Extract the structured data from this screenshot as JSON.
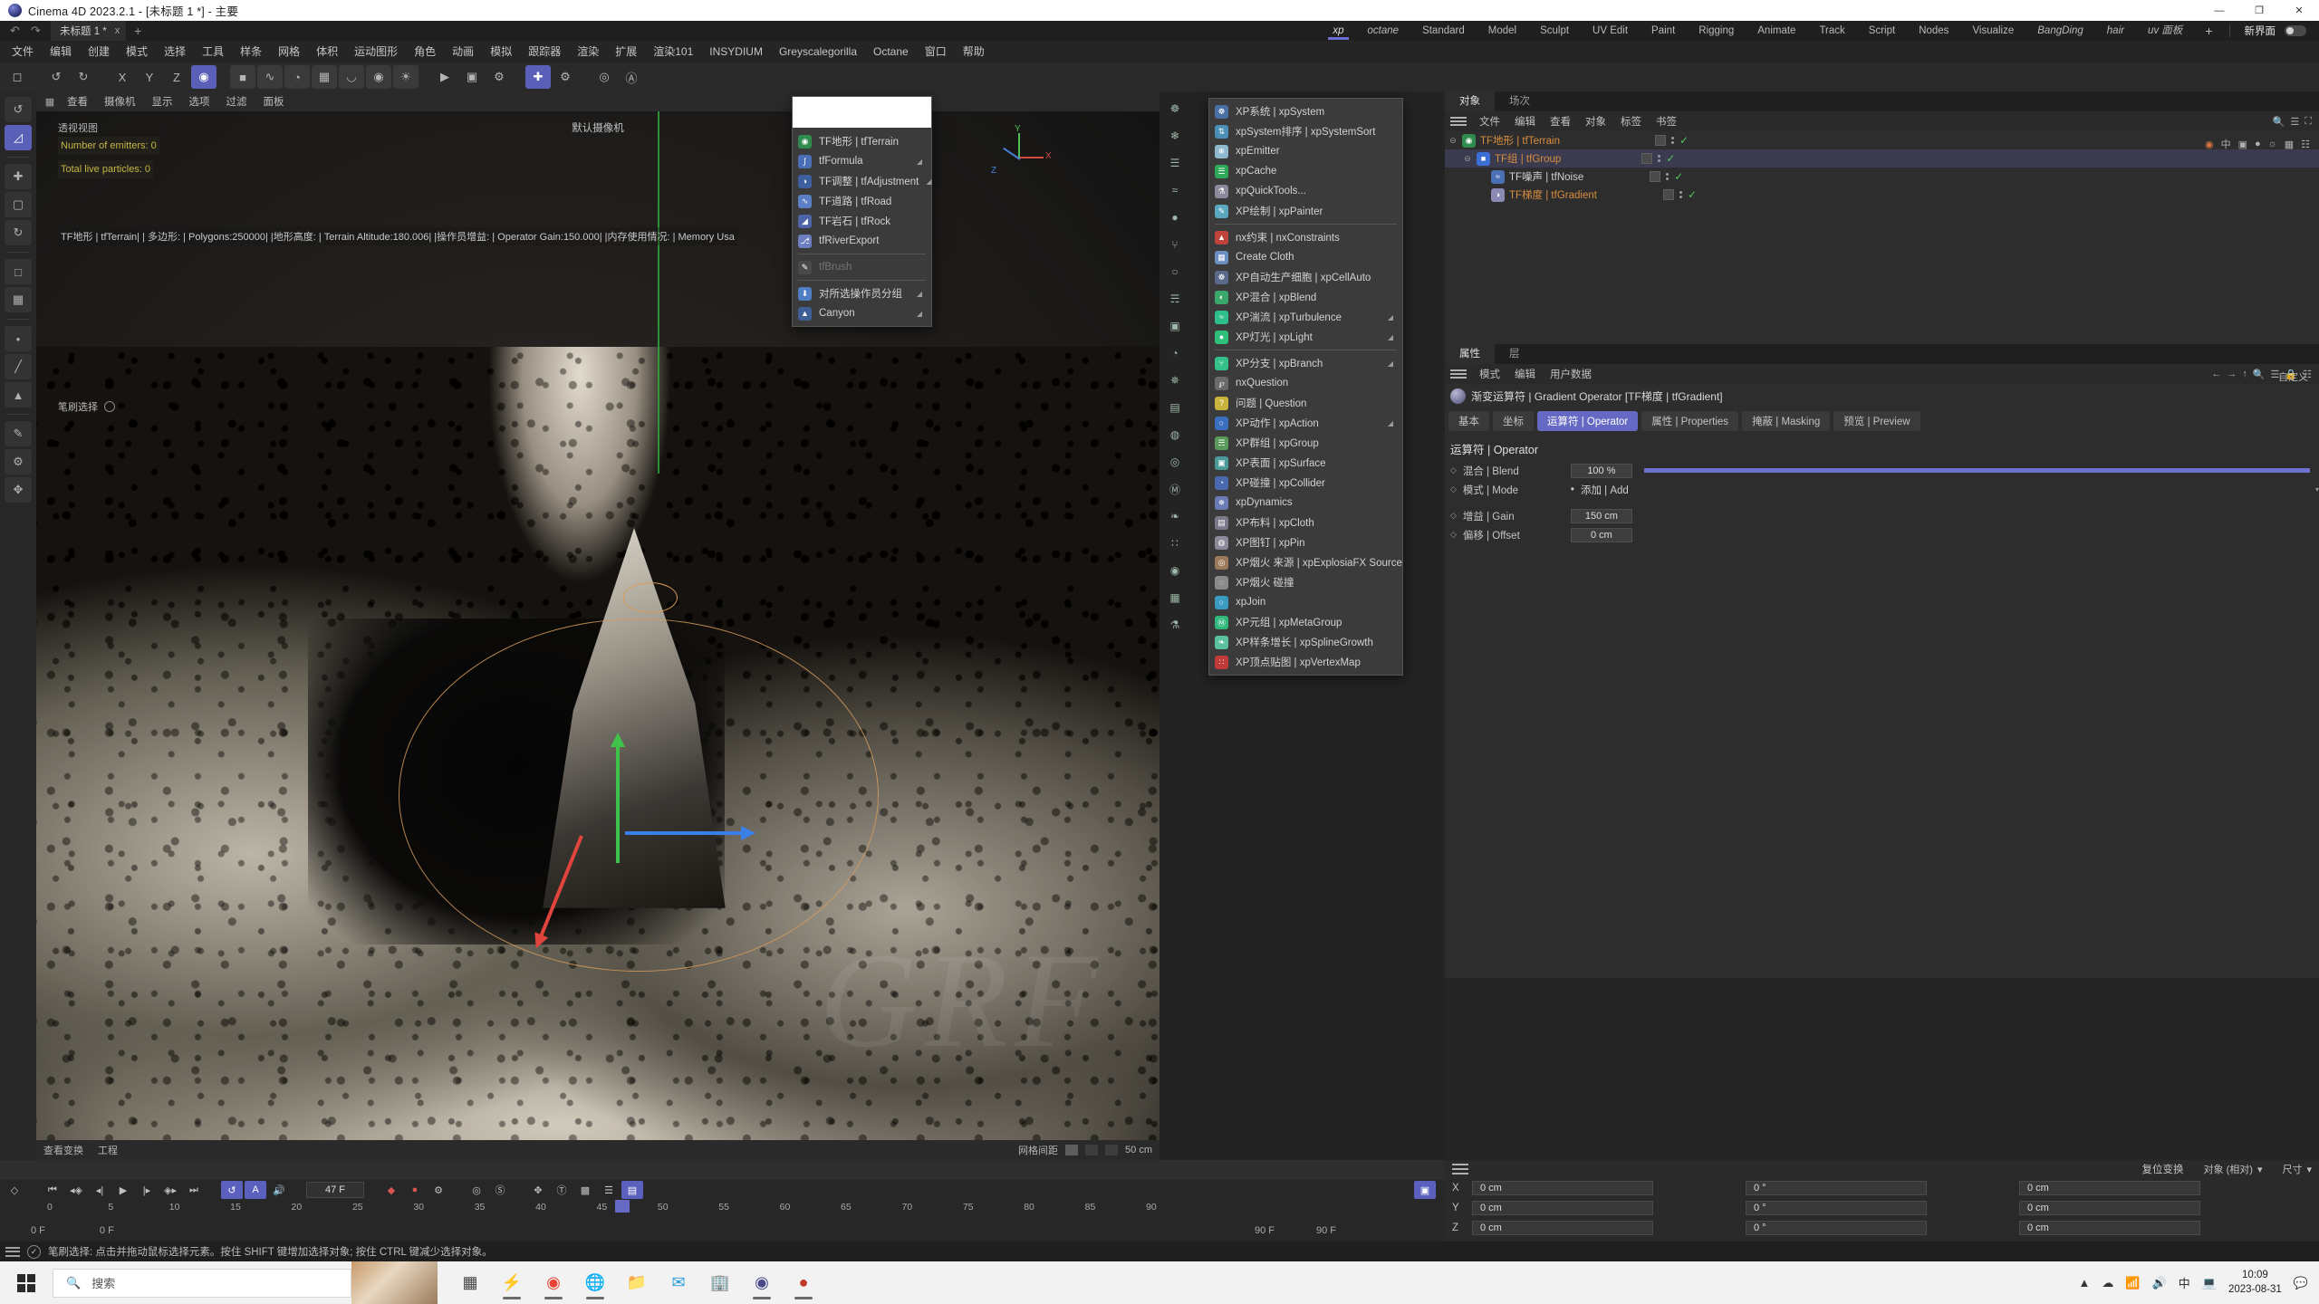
{
  "titlebar": {
    "title": "Cinema 4D 2023.2.1 - [未标题 1 *] - 主要",
    "minimize": "—",
    "maximize": "❐",
    "close": "✕"
  },
  "toprow": {
    "undo": "↶",
    "redo": "↷",
    "doc_tab": "未标题 1 *",
    "doc_tab_close": "x",
    "add_tab": "+",
    "layouts": [
      {
        "label": "xp",
        "active": true,
        "italic": true
      },
      {
        "label": "octane",
        "active": false,
        "italic": true
      },
      {
        "label": "Standard",
        "active": false,
        "italic": false
      },
      {
        "label": "Model",
        "active": false,
        "italic": false
      },
      {
        "label": "Sculpt",
        "active": false,
        "italic": false
      },
      {
        "label": "UV Edit",
        "active": false,
        "italic": false
      },
      {
        "label": "Paint",
        "active": false,
        "italic": false
      },
      {
        "label": "Rigging",
        "active": false,
        "italic": false
      },
      {
        "label": "Animate",
        "active": false,
        "italic": false
      },
      {
        "label": "Track",
        "active": false,
        "italic": false
      },
      {
        "label": "Script",
        "active": false,
        "italic": false
      },
      {
        "label": "Nodes",
        "active": false,
        "italic": false
      },
      {
        "label": "Visualize",
        "active": false,
        "italic": false
      },
      {
        "label": "BangDing",
        "active": false,
        "italic": true
      },
      {
        "label": "hair",
        "active": false,
        "italic": true
      },
      {
        "label": "uv 面板",
        "active": false,
        "italic": true
      }
    ],
    "layout_plus": "+",
    "new_ui_label": "新界面"
  },
  "menubar": [
    "文件",
    "编辑",
    "创建",
    "模式",
    "选择",
    "工具",
    "样条",
    "网格",
    "体积",
    "运动图形",
    "角色",
    "动画",
    "模拟",
    "跟踪器",
    "渲染",
    "扩展",
    "渲染101",
    "INSYDIUM",
    "Greyscalegorilla",
    "Octane",
    "窗口",
    "帮助"
  ],
  "viewport": {
    "header_items": [
      "查看",
      "摄像机",
      "显示",
      "选项",
      "过滤",
      "面板"
    ],
    "view_label": "透视视图",
    "camera_label": "默认摄像机",
    "emitters_line": "Number of emitters: 0",
    "particles_line": "Total live particles: 0",
    "info_line": "TF地形 | tfTerrain| | 多边形:  | Polygons:250000| |地形高度:  | Terrain Altitude:180.006| |操作员增益:  | Operator Gain:150.000| |内存使用情况:  | Memory Usa",
    "brush_select": "笔刷选择",
    "footer_left": "查看变换",
    "footer_left2": "工程",
    "footer_right": "网格间距",
    "footer_grid": "50 cm",
    "axis_x": "X",
    "axis_y": "Y",
    "axis_z": "Z",
    "watermark": "GRF"
  },
  "tf_menu": {
    "items": [
      {
        "label": "TF地形 | tfTerrain",
        "icon": "◉",
        "color": "#2f8c4e",
        "arrow": false,
        "dim": false
      },
      {
        "label": "tfFormula",
        "icon": "∫",
        "color": "#4a6fb5",
        "arrow": true,
        "dim": false
      },
      {
        "label": "TF调整 | tfAdjustment",
        "icon": "◑",
        "color": "#3d5f9e",
        "arrow": true,
        "dim": false
      },
      {
        "label": "TF道路 | tfRoad",
        "icon": "∿",
        "color": "#5b7fc7",
        "arrow": false,
        "dim": false
      },
      {
        "label": "TF岩石 | tfRock",
        "icon": "◢",
        "color": "#4d63a8",
        "arrow": false,
        "dim": false
      },
      {
        "label": "tfRiverExport",
        "icon": "⎇",
        "color": "#6d7fc0",
        "arrow": false,
        "dim": false
      },
      {
        "label": "tfBrush",
        "icon": "✎",
        "color": "#4a4a4a",
        "arrow": false,
        "dim": true
      },
      {
        "label": "对所选操作员分组",
        "icon": "⬇",
        "color": "#4f7ec4",
        "arrow": true,
        "dim": false
      },
      {
        "label": "Canyon",
        "icon": "▲",
        "color": "#3e5f96",
        "arrow": true,
        "dim": false
      }
    ]
  },
  "xp_menu": {
    "items": [
      {
        "label": "XP系统 | xpSystem",
        "icon": "☸",
        "color": "#4a6fa5",
        "arrow": false,
        "sep_after": false
      },
      {
        "label": "xpSystem排序 | xpSystemSort",
        "icon": "⇅",
        "color": "#4a8fb5",
        "arrow": false,
        "sep_after": false
      },
      {
        "label": "xpEmitter",
        "icon": "❄",
        "color": "#8fb8cf",
        "arrow": false,
        "sep_after": false
      },
      {
        "label": "xpCache",
        "icon": "☰",
        "color": "#2fa85a",
        "arrow": false,
        "sep_after": false
      },
      {
        "label": "xpQuickTools...",
        "icon": "⚗",
        "color": "#8a8a9a",
        "arrow": false,
        "sep_after": false
      },
      {
        "label": "XP绘制 | xpPainter",
        "icon": "✎",
        "color": "#5aa8c0",
        "arrow": false,
        "sep_after": true
      },
      {
        "label": "nx约束 | nxConstraints",
        "icon": "▲",
        "color": "#c0443c",
        "arrow": false,
        "sep_after": false
      },
      {
        "label": "Create Cloth",
        "icon": "▦",
        "color": "#6a8ec0",
        "arrow": false,
        "sep_after": false
      },
      {
        "label": "XP自动生产细胞 | xpCellAuto",
        "icon": "☸",
        "color": "#5a6a8a",
        "arrow": false,
        "sep_after": false
      },
      {
        "label": "XP混合 | xpBlend",
        "icon": "◐",
        "color": "#3aa86a",
        "arrow": false,
        "sep_after": false
      },
      {
        "label": "XP湍流 | xpTurbulence",
        "icon": "≈",
        "color": "#2fbf8a",
        "arrow": true,
        "sep_after": false
      },
      {
        "label": "XP灯光 | xpLight",
        "icon": "●",
        "color": "#2fbf7a",
        "arrow": true,
        "sep_after": true
      },
      {
        "label": "XP分支 | xpBranch",
        "icon": "⑂",
        "color": "#35c08a",
        "arrow": true,
        "sep_after": false
      },
      {
        "label": "nxQuestion",
        "icon": "℘",
        "color": "#6a6a6a",
        "arrow": false,
        "sep_after": false
      },
      {
        "label": "问题 | Question",
        "icon": "?",
        "color": "#c8b43c",
        "arrow": false,
        "sep_after": false
      },
      {
        "label": "XP动作 | xpAction",
        "icon": "○",
        "color": "#3a6fc0",
        "arrow": true,
        "sep_after": false
      },
      {
        "label": "XP群组 | xpGroup",
        "icon": "☴",
        "color": "#5a9a5a",
        "arrow": false,
        "sep_after": false
      },
      {
        "label": "XP表面 | xpSurface",
        "icon": "▣",
        "color": "#4a9a9a",
        "arrow": false,
        "sep_after": false
      },
      {
        "label": "XP碰撞 | xpCollider",
        "icon": "◔",
        "color": "#4a6ab0",
        "arrow": false,
        "sep_after": false
      },
      {
        "label": "xpDynamics",
        "icon": "✵",
        "color": "#6a7ab5",
        "arrow": false,
        "sep_after": false
      },
      {
        "label": "XP布料 | xpCloth",
        "icon": "▤",
        "color": "#7a7a8a",
        "arrow": false,
        "sep_after": false
      },
      {
        "label": "XP图钉 | xpPin",
        "icon": "◍",
        "color": "#8a8a9a",
        "arrow": false,
        "sep_after": false
      },
      {
        "label": "XP烟火 来源 | xpExplosiaFX Source",
        "icon": "◎",
        "color": "#9a7a5a",
        "arrow": false,
        "sep_after": false
      },
      {
        "label": "XP烟火 碰撞",
        "icon": "◌",
        "color": "#8a8a8a",
        "arrow": false,
        "sep_after": false
      },
      {
        "label": "xpJoin",
        "icon": "○",
        "color": "#3a9ac0",
        "arrow": false,
        "sep_after": false
      },
      {
        "label": "XP元组 | xpMetaGroup",
        "icon": "Ⓜ",
        "color": "#2fb87a",
        "arrow": false,
        "sep_after": false
      },
      {
        "label": "XP样条增长 | xpSplineGrowth",
        "icon": "❧",
        "color": "#5ac0a0",
        "arrow": false,
        "sep_after": false
      },
      {
        "label": "XP顶点贴图 | xpVertexMap",
        "icon": "∷",
        "color": "#c03a3a",
        "arrow": false,
        "sep_after": false
      }
    ]
  },
  "object_manager": {
    "tabs": [
      {
        "label": "对象",
        "active": true
      },
      {
        "label": "场次",
        "active": false
      }
    ],
    "menu": [
      "文件",
      "编辑",
      "查看",
      "对象",
      "标签",
      "书签"
    ],
    "rows": [
      {
        "label": "TF地形 | tfTerrain",
        "indent": 0,
        "icon": "◉",
        "color": "#2f8c4e",
        "orange": true,
        "selected": false,
        "expander": "⊖"
      },
      {
        "label": "TF组 | tfGroup",
        "indent": 1,
        "icon": "■",
        "color": "#3b6fd4",
        "orange": true,
        "selected": true,
        "expander": "⊖"
      },
      {
        "label": "TF噪声 | tfNoise",
        "indent": 2,
        "icon": "≈",
        "color": "#4a6fb5",
        "orange": false,
        "selected": false,
        "expander": ""
      },
      {
        "label": "TF梯度 | tfGradient",
        "indent": 2,
        "icon": "◑",
        "color": "#8a8ab5",
        "orange": true,
        "selected": false,
        "expander": ""
      }
    ]
  },
  "attributes": {
    "tabs": [
      {
        "label": "属性",
        "active": true
      },
      {
        "label": "层",
        "active": false
      }
    ],
    "menu": [
      "模式",
      "编辑",
      "用户数据"
    ],
    "custom_label": "自定义",
    "object_title": "渐变运算符 | Gradient Operator [TF梯度 | tfGradient]",
    "tabs_row": [
      {
        "label": "基本",
        "active": false
      },
      {
        "label": "坐标",
        "active": false
      },
      {
        "label": "运算符 | Operator",
        "active": true
      },
      {
        "label": "属性 | Properties",
        "active": false
      },
      {
        "label": "掩蔽 | Masking",
        "active": false
      },
      {
        "label": "预览 | Preview",
        "active": false
      }
    ],
    "section_title": "运算符 | Operator",
    "rows": [
      {
        "label": "混合 | Blend",
        "value": "100 %",
        "type": "slider"
      },
      {
        "label": "模式 | Mode",
        "value": "添加 | Add",
        "type": "dropdown"
      },
      {
        "label": "增益 | Gain",
        "value": "150 cm",
        "type": "field"
      },
      {
        "label": "偏移 | Offset",
        "value": "0 cm",
        "type": "field"
      }
    ]
  },
  "coordinates": {
    "mode_label": "复位变换",
    "object_label": "对象 (相对)",
    "size_label": "尺寸",
    "rows": [
      {
        "axis": "X",
        "pos": "0 cm",
        "rot": "0 °",
        "size": "0 cm"
      },
      {
        "axis": "Y",
        "pos": "0 cm",
        "rot": "0 °",
        "size": "0 cm"
      },
      {
        "axis": "Z",
        "pos": "0 cm",
        "rot": "0 °",
        "size": "0 cm"
      }
    ]
  },
  "timeline": {
    "current_frame": "47 F",
    "start_frame": "0 F",
    "start_frame2": "0 F",
    "end_frame": "90 F",
    "end_frame2": "90 F",
    "ticks": [
      "0",
      "5",
      "10",
      "15",
      "20",
      "25",
      "30",
      "35",
      "40",
      "45",
      "50",
      "55",
      "60",
      "65",
      "70",
      "75",
      "80",
      "85",
      "90"
    ],
    "playhead_label": "47"
  },
  "statusbar": {
    "text": "笔刷选择: 点击并拖动鼠标选择元素。按住 SHIFT 键增加选择对象; 按住 CTRL 键减少选择对象。"
  },
  "taskbar": {
    "search_placeholder": "搜索",
    "clock_time": "10:09",
    "clock_date": "2023-08-31"
  },
  "colors": {
    "accent": "#6569c4",
    "orange": "#d98d3f",
    "green_check": "#4ec45a",
    "yellow_hud": "#c6b545",
    "selection_ring": "#d79b5a"
  }
}
